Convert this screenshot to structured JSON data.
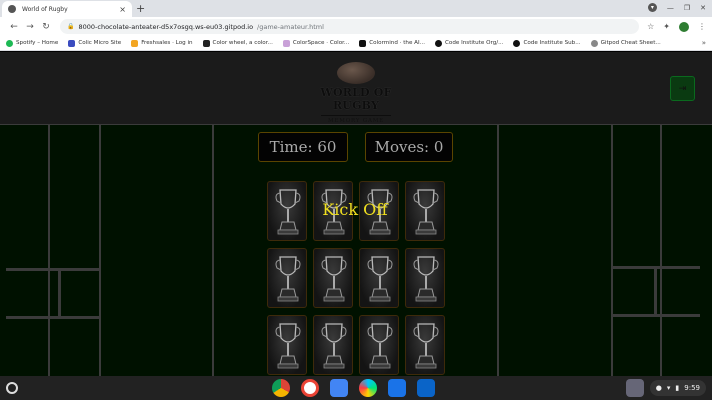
{
  "browser": {
    "tab_title": "World of Rugby",
    "tab_close": "×",
    "new_tab": "+",
    "url_host": "8000-chocolate-anteater-d5x7osgq.ws-eu03.gitpod.io",
    "url_path": "/game-amateur.html",
    "nav": {
      "back": "←",
      "forward": "→",
      "reload": "C"
    },
    "bookmarks": [
      "Spotify – Home",
      "Colic Micro Site",
      "Freshsales · Log in",
      "Color wheel, a color...",
      "ColorSpace · Color...",
      "Colormind · the AI...",
      "Code Institute Org/...",
      "Code Institute Sub...",
      "Gitpod Cheat Sheet..."
    ],
    "bookmarks_more": "»"
  },
  "site": {
    "brand": "WORLD OF RUGBY",
    "subtitle": "MEMORY GAME",
    "exit_icon": "⇥"
  },
  "game": {
    "time_text": "Time: 60",
    "moves_text": "Moves: 0",
    "overlay_text": "Kick Off",
    "card_face": "trophy-icon"
  },
  "shelf": {
    "apps": [
      "chrome",
      "gmail",
      "docs",
      "play-store",
      "files",
      "outlook"
    ],
    "clock": "9:59"
  },
  "colors": {
    "overlay_text": "#f0e020",
    "field": "#001100",
    "card_border": "#3e2a0a"
  }
}
